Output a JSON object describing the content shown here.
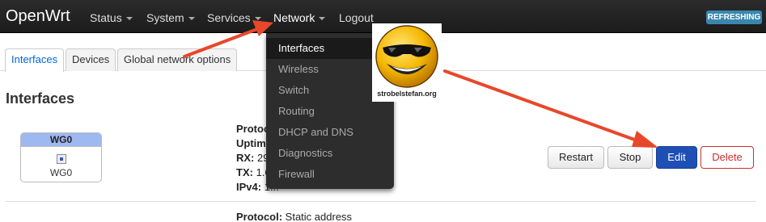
{
  "topbar": {
    "brand": "OpenWrt",
    "nav": [
      "Status",
      "System",
      "Services",
      "Network",
      "Logout"
    ],
    "refreshing": "REFRESHING"
  },
  "tabs": [
    "Interfaces",
    "Devices",
    "Global network options"
  ],
  "section_title": "Interfaces",
  "network_menu": [
    "Interfaces",
    "Wireless",
    "Switch",
    "Routing",
    "DHCP and DNS",
    "Diagnostics",
    "Firewall"
  ],
  "interface": {
    "badge_name": "WG0",
    "label": "WG0",
    "info_lines": [
      {
        "key": "Protoc",
        "value": ""
      },
      {
        "key": "Uptim",
        "value": ""
      },
      {
        "key": "RX:",
        "value": " 29"
      },
      {
        "key": "TX:",
        "value": " 1.6"
      },
      {
        "key": "IPv4:",
        "value": " 1..."
      }
    ]
  },
  "next_interface": {
    "key": "Protocol:",
    "value": " Static address"
  },
  "buttons": {
    "restart": "Restart",
    "stop": "Stop",
    "edit": "Edit",
    "delete": "Delete"
  },
  "logo": {
    "caption": "strobelstefan.org"
  },
  "colors": {
    "arrow": "#e8472b",
    "edit": "#1e4fb5",
    "delete": "#c9302c",
    "badge_head": "#9eb8f0"
  }
}
